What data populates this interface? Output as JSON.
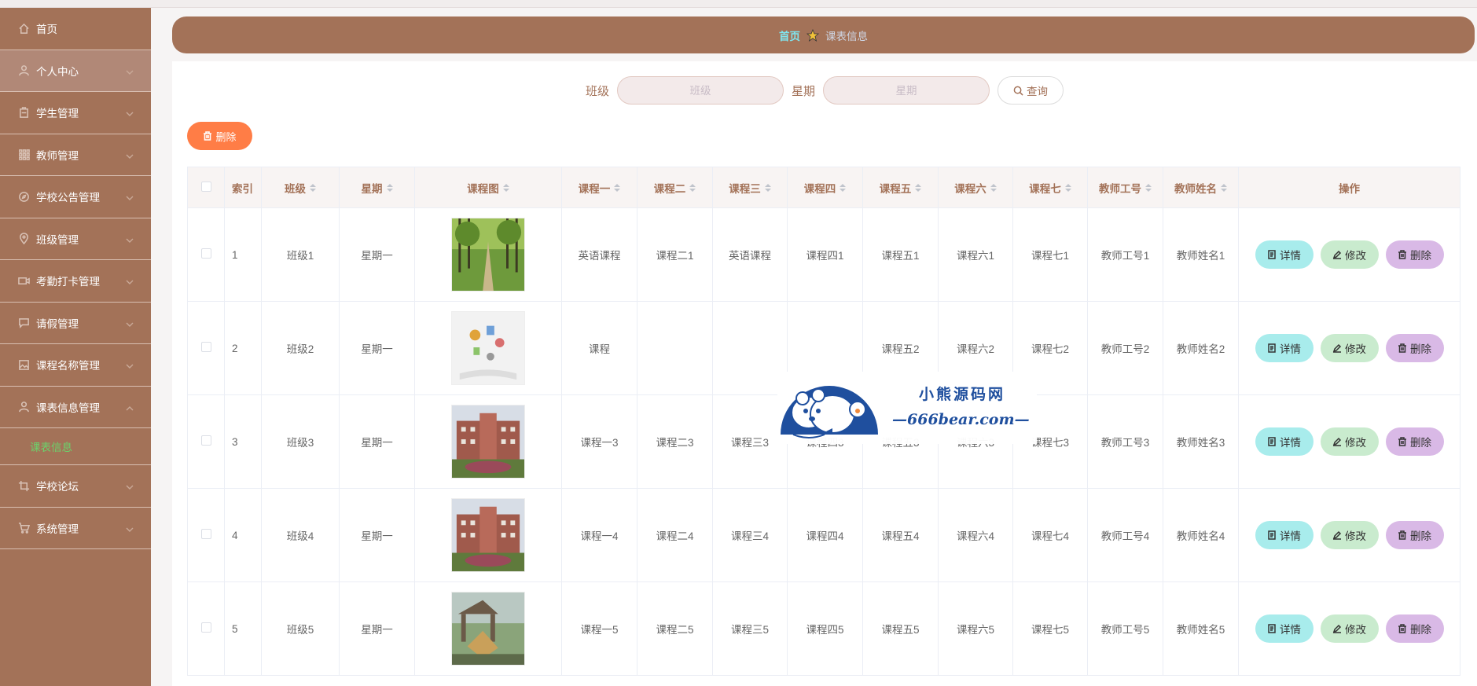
{
  "sidebar": {
    "items": [
      {
        "label": "首页",
        "icon": "home-icon",
        "has_arrow": false
      },
      {
        "label": "个人中心",
        "icon": "user-icon",
        "has_arrow": true,
        "active": true
      },
      {
        "label": "学生管理",
        "icon": "student-icon",
        "has_arrow": true
      },
      {
        "label": "教师管理",
        "icon": "grid-icon",
        "has_arrow": true
      },
      {
        "label": "学校公告管理",
        "icon": "compass-icon",
        "has_arrow": true
      },
      {
        "label": "班级管理",
        "icon": "location-icon",
        "has_arrow": true
      },
      {
        "label": "考勤打卡管理",
        "icon": "video-icon",
        "has_arrow": true
      },
      {
        "label": "请假管理",
        "icon": "chat-icon",
        "has_arrow": true
      },
      {
        "label": "课程名称管理",
        "icon": "picture-icon",
        "has_arrow": true
      },
      {
        "label": "课表信息管理",
        "icon": "user-icon",
        "has_arrow": true,
        "expanded": true
      },
      {
        "label": "学校论坛",
        "icon": "crop-icon",
        "has_arrow": true
      },
      {
        "label": "系统管理",
        "icon": "cart-icon",
        "has_arrow": true
      }
    ],
    "submenu": {
      "label": "课表信息"
    }
  },
  "breadcrumb": {
    "home": "首页",
    "current": "课表信息"
  },
  "search": {
    "class_label": "班级",
    "class_placeholder": "班级",
    "week_label": "星期",
    "week_placeholder": "星期",
    "query_label": "查询"
  },
  "toolbar": {
    "delete_label": "删除"
  },
  "table": {
    "headers": {
      "index": "索引",
      "class": "班级",
      "week": "星期",
      "image": "课程图",
      "c1": "课程一",
      "c2": "课程二",
      "c3": "课程三",
      "c4": "课程四",
      "c5": "课程五",
      "c6": "课程六",
      "c7": "课程七",
      "teacher_no": "教师工号",
      "teacher_name": "教师姓名",
      "ops": "操作"
    },
    "rows": [
      {
        "index": "1",
        "class": "班级1",
        "week": "星期一",
        "c1": "英语课程",
        "c2": "课程二1",
        "c3": "英语课程",
        "c4": "课程四1",
        "c5": "课程五1",
        "c6": "课程六1",
        "c7": "课程七1",
        "teacher_no": "教师工号1",
        "teacher_name": "教师姓名1"
      },
      {
        "index": "2",
        "class": "班级2",
        "week": "星期一",
        "c1": "课程",
        "c2": "",
        "c3": "",
        "c4": "",
        "c5": "课程五2",
        "c6": "课程六2",
        "c7": "课程七2",
        "teacher_no": "教师工号2",
        "teacher_name": "教师姓名2"
      },
      {
        "index": "3",
        "class": "班级3",
        "week": "星期一",
        "c1": "课程一3",
        "c2": "课程二3",
        "c3": "课程三3",
        "c4": "课程四3",
        "c5": "课程五3",
        "c6": "课程六3",
        "c7": "课程七3",
        "teacher_no": "教师工号3",
        "teacher_name": "教师姓名3"
      },
      {
        "index": "4",
        "class": "班级4",
        "week": "星期一",
        "c1": "课程一4",
        "c2": "课程二4",
        "c3": "课程三4",
        "c4": "课程四4",
        "c5": "课程五4",
        "c6": "课程六4",
        "c7": "课程七4",
        "teacher_no": "教师工号4",
        "teacher_name": "教师姓名4"
      },
      {
        "index": "5",
        "class": "班级5",
        "week": "星期一",
        "c1": "课程一5",
        "c2": "课程二5",
        "c3": "课程三5",
        "c4": "课程四5",
        "c5": "课程五5",
        "c6": "课程六5",
        "c7": "课程七5",
        "teacher_no": "教师工号5",
        "teacher_name": "教师姓名5"
      }
    ],
    "ops": {
      "detail": "详情",
      "edit": "修改",
      "delete": "删除"
    }
  },
  "watermark": {
    "title": "小熊源码网",
    "url": "—666bear.com—"
  },
  "colors": {
    "brand": "#a37258",
    "accent_home": "#7fe6f0",
    "submenu_active": "#6bd26b",
    "delete_button": "#ff7d46"
  }
}
